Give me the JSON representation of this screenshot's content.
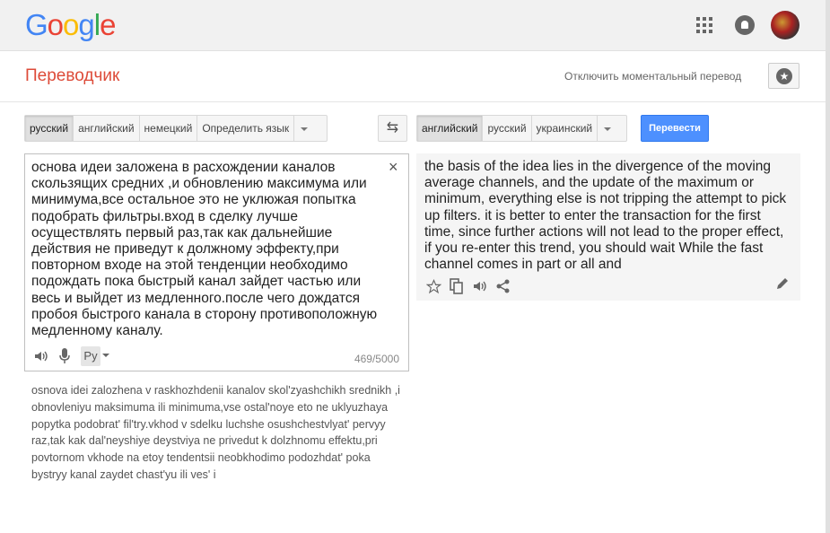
{
  "brand": {
    "logo_letters": [
      "G",
      "o",
      "o",
      "g",
      "l",
      "e"
    ]
  },
  "header": {
    "title": "Переводчик",
    "instant_toggle": "Отключить моментальный перевод"
  },
  "source": {
    "langs": [
      "русский",
      "английский",
      "немецкий",
      "Определить язык"
    ],
    "active_lang": "русский",
    "text": "основа идеи заложена в расхождении каналов\nскользящих средних ,и обновлению максимума или\nминимума,все остальное это не уклюжая попытка\nподобрать фильтры.вход в сделку лучше\nосуществлять первый раз,так как дальнейшие\nдействия не приведут к должному эффекту,при\nповторном входе на этой тенденции необходимо\nподождать пока быстрый канал зайдет частью или\nвесь и выйдет из медленного.после чего дождатся\nпробоя быстрого канала в сторону противоположную\nмедленному каналу.",
    "char_count": "469/5000",
    "ime_label": "Ру",
    "clear_icon": "×"
  },
  "swap_icon": "⇆",
  "target": {
    "langs": [
      "английский",
      "русский",
      "украинский"
    ],
    "active_lang": "английский",
    "translate_button": "Перевести",
    "text": "the basis of the idea lies in the divergence of the moving average channels, and the update of the maximum or minimum, everything else is not tripping the attempt to pick up filters. it is better to enter the transaction for the first time, since further actions will not lead to the proper effect, if you re-enter this trend, you should wait While the fast channel comes in part or all and"
  },
  "transliteration": "osnova idei zalozhena v raskhozhdenii kanalov skol'zyashchikh srednikh ,i obnovleniyu maksimuma ili minimuma,vse ostal'noye eto ne uklyuzhaya popytka podobrat' fil'try.vkhod v sdelku luchshe osushchestvlyat' pervyy raz,tak kak dal'neyshiye deystviya ne privedut k dolzhnomu effektu,pri povtornom vkhode na etoy tendentsii neobkhodimo podozhdat' poka bystryy kanal zaydet chast'yu ili ves' i",
  "colors": {
    "accent_blue": "#4d90fe",
    "title_red": "#dd4b39",
    "logo_blue": "#4285f4",
    "logo_red": "#ea4335",
    "logo_yellow": "#fbbc05",
    "logo_green": "#34a853"
  },
  "icons": {
    "apps": "apps-grid-icon",
    "notifications": "bell-icon",
    "star": "star-icon",
    "speaker": "speaker-icon",
    "mic": "microphone-icon",
    "copy": "copy-icon",
    "share": "share-icon",
    "edit": "pencil-icon"
  }
}
